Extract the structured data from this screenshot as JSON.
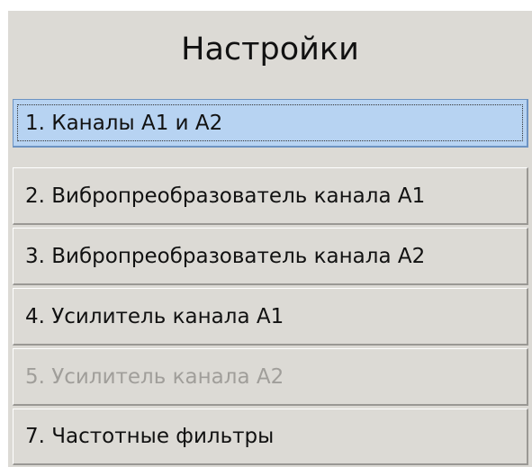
{
  "title": "Настройки",
  "buttons": [
    {
      "label": "1. Каналы А1 и А2",
      "state": "selected"
    },
    {
      "label": "2. Вибропреобразователь канала А1",
      "state": "normal"
    },
    {
      "label": "3. Вибропреобразователь канала А2",
      "state": "normal"
    },
    {
      "label": "4. Усилитель канала А1",
      "state": "normal"
    },
    {
      "label": "5. Усилитель канала А2",
      "state": "disabled"
    },
    {
      "label": "7. Частотные фильтры",
      "state": "normal"
    }
  ]
}
